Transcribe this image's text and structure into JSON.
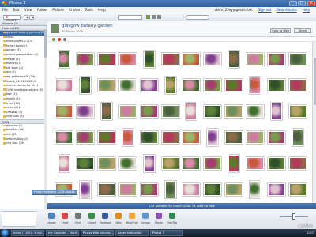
{
  "window": {
    "title": "Picasa 3"
  },
  "menu": [
    "File",
    "Edit",
    "View",
    "Folder",
    "Picture",
    "Create",
    "Tools",
    "Help"
  ],
  "account": {
    "email": "cklim123ey@gmail.com",
    "sign_out": "Sign out",
    "web_albums": "Web Albums",
    "help": "Help"
  },
  "toolbar": {
    "import_label": "Import"
  },
  "left_panel": {
    "albums_header": "Albums (1)",
    "folders_header": "Folders (80)",
    "selected_item": "glasgow botany garden (23)",
    "items": [
      "glasgow botany garden (23)",
      "Mitsu",
      "kites project 2 (23)",
      "ferrari today (1)",
      "accom (3)",
      "poster presentation (1)",
      "image (1)",
      "finance (1)",
      "old book (6)",
      "doc (1)",
      "my gathering08 (34)",
      "Scans_24-01-2008 (1)",
      "Search results for ok (1)",
      "QMU meetsgoesat pics (5)",
      "test (2)",
      "health (2)",
      "trees (10)",
      "referral (1)",
      "Desktop (1)",
      "new pdfs (5)"
    ],
    "year_label": "2008",
    "items_2008": [
      "glasgow (1)",
      "bath kst (16)",
      "hot (15)",
      "makers blog (3)",
      "city tour (38)"
    ]
  },
  "album": {
    "title": "glasgow botany garden",
    "date": "30 March 2008",
    "sync_label": "Sync to Web",
    "share_label": "Share"
  },
  "status": {
    "text": "233 pictures   30 March 2008   74.5MB on disk"
  },
  "tray": {
    "hold_label": "Folder Selected - 233 photos",
    "buttons": [
      "Upload",
      "Email",
      "Print",
      "Export",
      "Facebook",
      "Web",
      "BlogThis!",
      "Collage",
      "Movie",
      "GeoTag"
    ]
  },
  "taskbar": {
    "tasks": [
      "inbox (1,0,0) - kunyi...",
      "my Capsules - Mozill...",
      "Picasa Web Albums -...",
      "paper evaluation",
      "Picasa 3"
    ],
    "clock": "2:07"
  },
  "watermark": "cklim"
}
